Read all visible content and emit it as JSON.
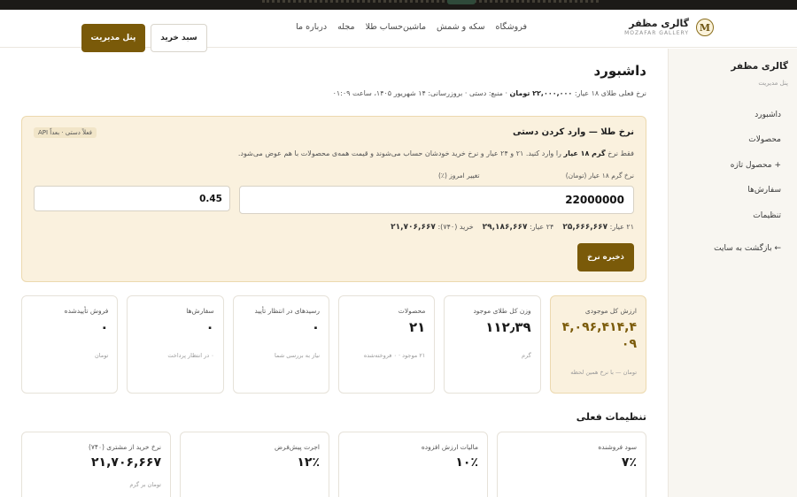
{
  "brand": {
    "logo_letter": "M",
    "name": "گالری مظفر",
    "subtitle": "MOZAFAR GALLERY"
  },
  "nav": [
    "فروشگاه",
    "سکه و شمش",
    "ماشین‌حساب طلا",
    "مجله",
    "درباره ما"
  ],
  "header_buttons": {
    "cart": "سبد خرید",
    "admin": "پنل مدیریت"
  },
  "sidebar": {
    "title": "گالری مظفر",
    "subtitle": "پنل مدیریت",
    "items": [
      "داشبورد",
      "محصولات",
      "+ محصول تازه",
      "سفارش‌ها",
      "تنظیمات"
    ],
    "back": "← بازگشت به سایت"
  },
  "page": {
    "title": "داشبورد",
    "rate_line": {
      "label": "نرخ فعلی طلای ۱۸ عیار:",
      "value": "۲۲,۰۰۰,۰۰۰ تومان",
      "rest": "· منبع: دستی · بروزرسانی: ۱۴ شهریور ۱۴۰۵، ساعت ۰۱:۰۹"
    }
  },
  "rate_card": {
    "title": "نرخ طلا — وارد کردن دستی",
    "badge": "فعلاً دستی · بعداً API",
    "desc_pre": "فقط نرخ",
    "desc_bold": "گرم ۱۸ عیار",
    "desc_post": "را وارد کنید. ۲۱ و ۲۴ عیار و نرخ خرید خودشان حساب می‌شوند و قیمت همه‌ی محصولات با هم عوض می‌شود.",
    "main_label": "نرخ گرم ۱۸ عیار (تومان)",
    "main_value": "22000000",
    "change_label": "تغییر امروز (٪)",
    "change_value": "0.45",
    "karats": [
      {
        "label": "۲۱ عیار:",
        "value": "۲۵,۶۶۶,۶۶۷"
      },
      {
        "label": "۲۴ عیار:",
        "value": "۲۹,۱۸۶,۶۶۷"
      },
      {
        "label": "خرید (۷۴۰):",
        "value": "۲۱,۷۰۶,۶۶۷"
      }
    ],
    "save_button": "ذخیره نرخ"
  },
  "stats": [
    {
      "label": "ارزش کل موجودی",
      "value": "۴,۰۹۶,۴۱۴,۴۰۹",
      "note": "تومان — با نرخ همین لحظه"
    },
    {
      "label": "وزن کل طلای موجود",
      "value": "۱۱۲٫۳۹",
      "note": "گرم"
    },
    {
      "label": "محصولات",
      "value": "۲۱",
      "note": "۲۱ موجود · ۰ فروخته‌شده"
    },
    {
      "label": "رسیدهای در انتظار تأیید",
      "value": "۰",
      "note": "نیاز به بررسی شما"
    },
    {
      "label": "سفارش‌ها",
      "value": "۰",
      "note": "۰ در انتظار پرداخت"
    },
    {
      "label": "فروش تأییدشده",
      "value": "۰",
      "note": "تومان"
    }
  ],
  "settings_title": "تنظیمات فعلی",
  "settings": [
    {
      "label": "سود فروشنده",
      "value": "۷٪",
      "note": ""
    },
    {
      "label": "مالیات ارزش افزوده",
      "value": "۱۰٪",
      "note": ""
    },
    {
      "label": "اجرت پیش‌فرض",
      "value": "۱۲٪",
      "note": ""
    },
    {
      "label": "نرخ خرید از مشتری (۷۴۰)",
      "value": "۲۱,۷۰۶,۶۶۷",
      "note": "تومان بر گرم"
    }
  ]
}
